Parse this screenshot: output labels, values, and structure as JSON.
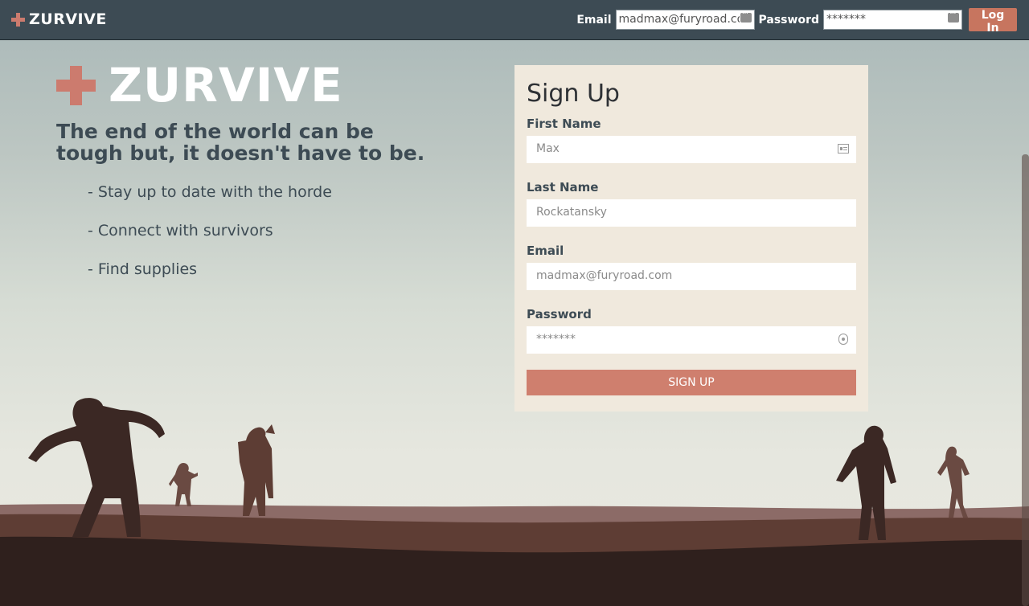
{
  "navbar": {
    "brand": "ZURVIVE",
    "email_label": "Email",
    "email_value": "madmax@furyroad.com",
    "password_label": "Password",
    "password_value": "*******",
    "login_label": "Log In"
  },
  "hero": {
    "brand": "ZURVIVE",
    "tagline": "The end of the world can be tough but, it doesn't have to be.",
    "features": [
      "- Stay up to date with the horde",
      "- Connect with survivors",
      "- Find supplies"
    ]
  },
  "signup": {
    "title": "Sign Up",
    "first_name": {
      "label": "First Name",
      "placeholder": "Max"
    },
    "last_name": {
      "label": "Last Name",
      "placeholder": "Rockatansky"
    },
    "email": {
      "label": "Email",
      "placeholder": "madmax@furyroad.com"
    },
    "password": {
      "label": "Password",
      "placeholder": "*******"
    },
    "submit_label": "SIGN UP"
  },
  "colors": {
    "navbar": "#3d4b54",
    "accent": "#cc7b6e",
    "button": "#cf7f6e",
    "card": "#f0e9dd",
    "text_dark": "#3d4b54"
  },
  "icons": [
    "plus-logo-icon",
    "password-key-icon",
    "contact-card-icon",
    "password-lock-icon",
    "zombie-silhouette"
  ]
}
